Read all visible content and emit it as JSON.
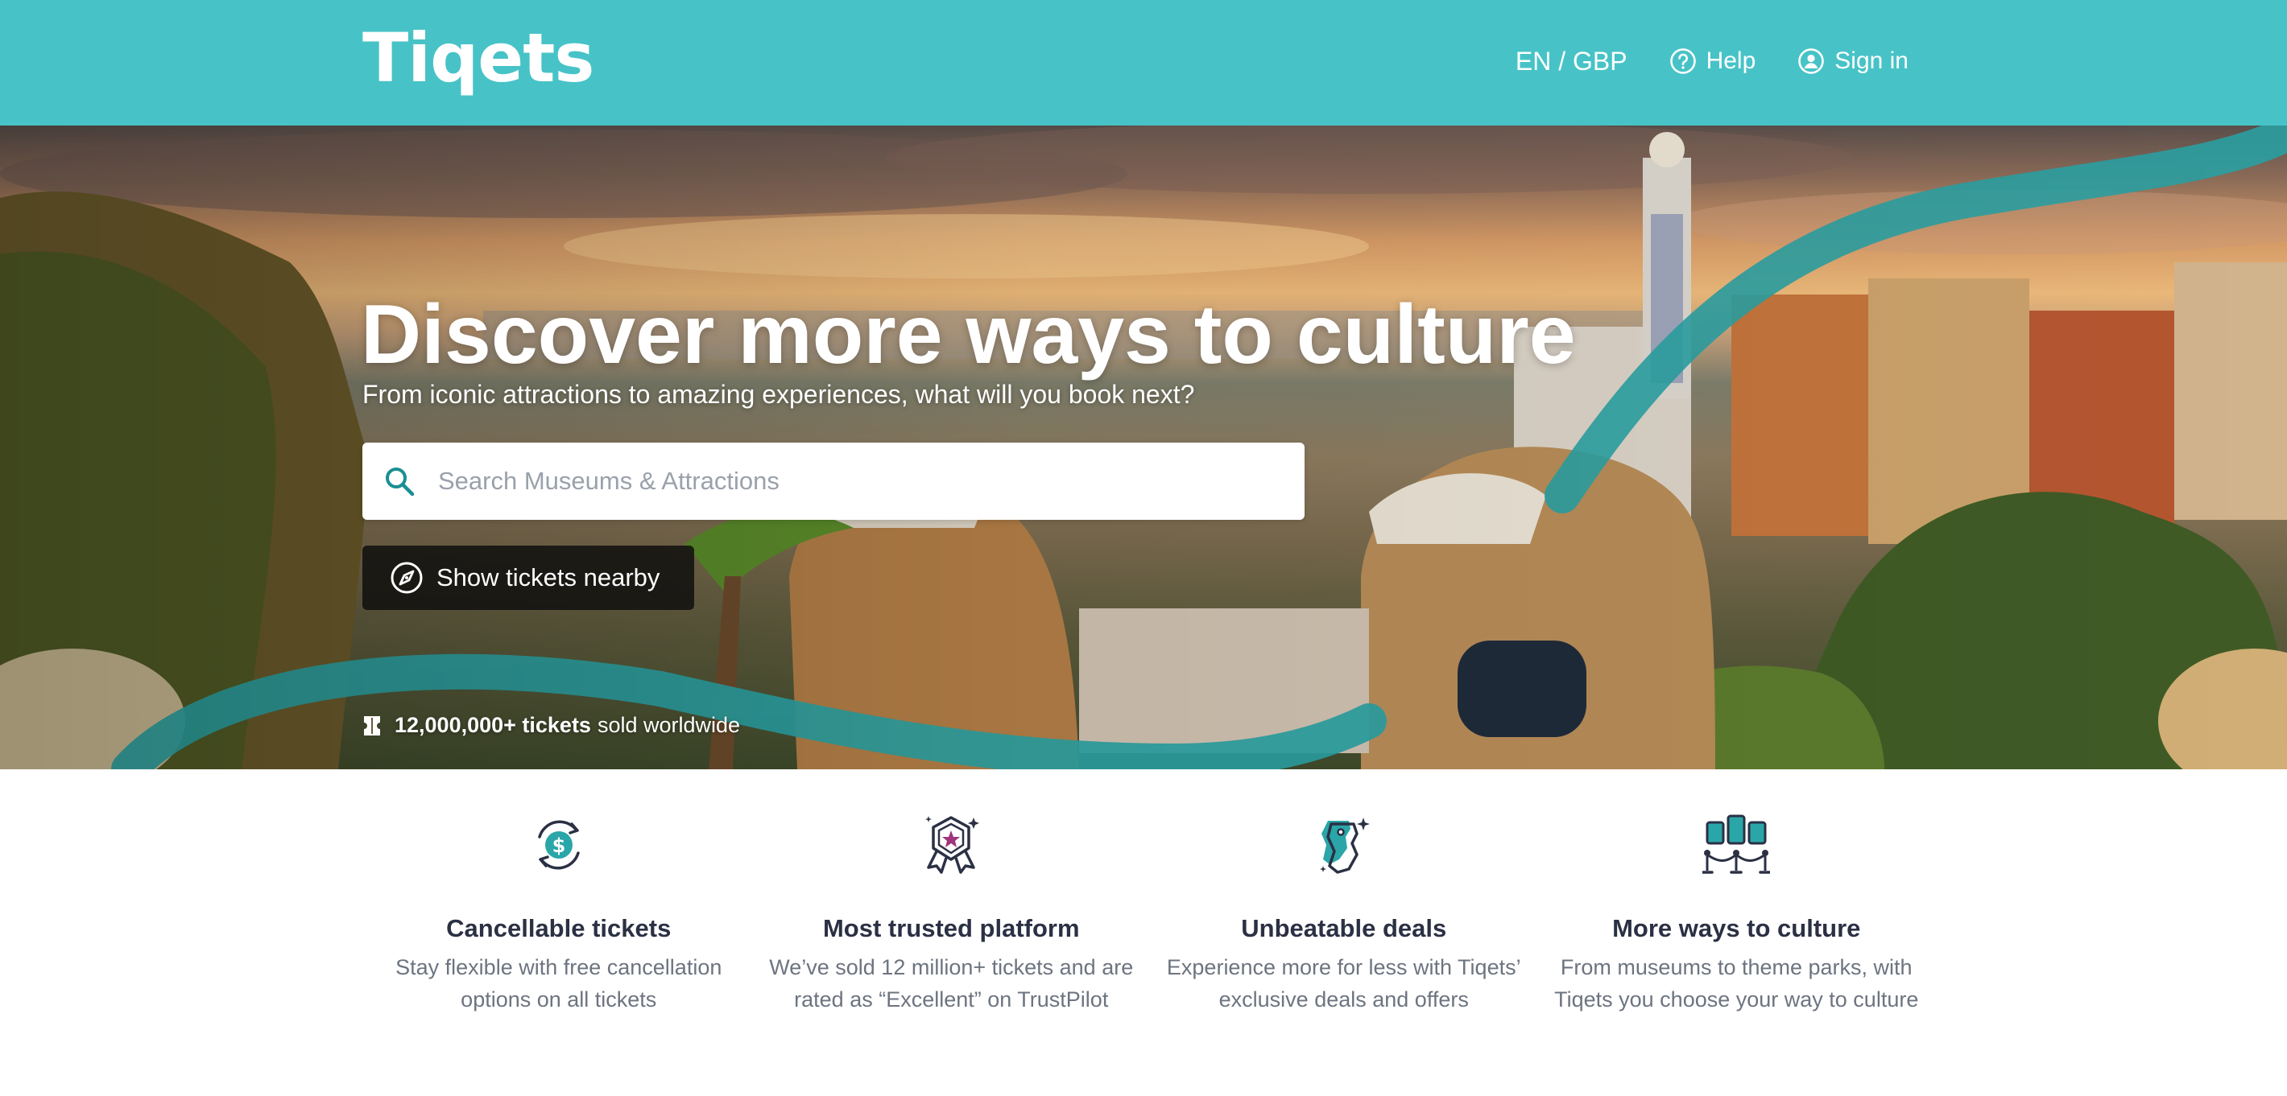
{
  "header": {
    "logo": "Tiqets",
    "language_currency": "EN / GBP",
    "help_label": "Help",
    "signin_label": "Sign in"
  },
  "hero": {
    "title": "Discover more ways to culture",
    "subtitle": "From iconic attractions to amazing experiences, what will you book next?",
    "search_placeholder": "Search Museums & Attractions",
    "search_value": "",
    "nearby_label": "Show tickets nearby",
    "sold_count": "12,000,000+ tickets",
    "sold_suffix": "sold worldwide"
  },
  "features": [
    {
      "icon": "cancellable-ticket-icon",
      "title": "Cancellable tickets",
      "text": "Stay flexible with free cancellation options on all tickets"
    },
    {
      "icon": "trusted-badge-icon",
      "title": "Most trusted platform",
      "text": "We’ve sold 12 million+ tickets and are rated as “Excellent” on TrustPilot"
    },
    {
      "icon": "deals-tag-icon",
      "title": "Unbeatable deals",
      "text": "Experience more for less with Tiqets’ exclusive deals and offers"
    },
    {
      "icon": "culture-exhibit-icon",
      "title": "More ways to culture",
      "text": "From museums to theme parks, with Tiqets you choose your way to culture"
    }
  ],
  "colors": {
    "brand_teal": "#47c3c7",
    "dark_text": "#2b3044",
    "muted_text": "#6d7480"
  }
}
